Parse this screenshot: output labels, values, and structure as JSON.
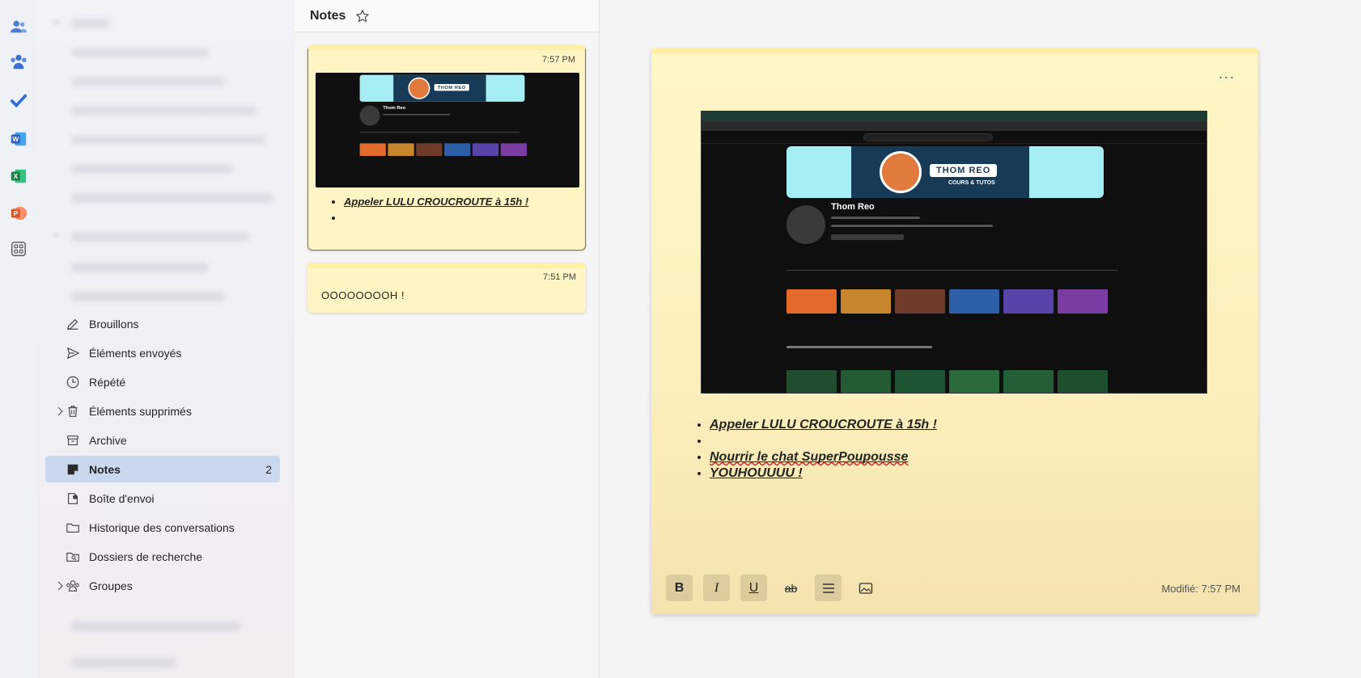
{
  "rail": {
    "icons": [
      "people-icon",
      "teams-icon",
      "todo-icon",
      "word-icon",
      "excel-icon",
      "powerpoint-icon",
      "apps-icon"
    ],
    "colors": {
      "people": "#4a7dd6",
      "teams": "#3a6fd1",
      "todo": "#2f6ed8",
      "word": "#2b5fbd",
      "excel": "#1e7f45",
      "powerpoint": "#d45a2f",
      "apps": "#555555"
    }
  },
  "folders": {
    "items": [
      {
        "label": "Brouillons",
        "icon": "draft-icon"
      },
      {
        "label": "Éléments envoyés",
        "icon": "send-icon"
      },
      {
        "label": "Répété",
        "icon": "clock-icon"
      },
      {
        "label": "Éléments supprimés",
        "icon": "trash-icon"
      },
      {
        "label": "Archive",
        "icon": "archive-icon"
      },
      {
        "label": "Notes",
        "icon": "note-icon",
        "count": "2"
      },
      {
        "label": "Boîte d'envoi",
        "icon": "outbox-icon"
      },
      {
        "label": "Historique des conversations",
        "icon": "folder-icon"
      },
      {
        "label": "Dossiers de recherche",
        "icon": "search-folder-icon"
      },
      {
        "label": "Groupes",
        "icon": "groups-icon"
      }
    ],
    "selected": "Notes"
  },
  "list": {
    "title": "Notes",
    "notes": [
      {
        "time": "7:57 PM",
        "items": [
          "Appeler LULU CROUCROUTE à 15h !",
          ""
        ]
      },
      {
        "time": "7:51 PM",
        "text": "OOOOOOOOH !"
      }
    ]
  },
  "editor": {
    "items": [
      "Appeler LULU CROUCROUTE à 15h !",
      "",
      "Nourrir le chat SuperPoupousse",
      "YOUHOUUUU !"
    ],
    "toolbar": {
      "bold": "B",
      "italic": "I",
      "underline": "U",
      "strike": "ab"
    },
    "modified": "Modifié: 7:57 PM",
    "image": {
      "channel_name": "Thom Reo",
      "banner_text": "THOM REO",
      "banner_sub": "COURS & TUTOS"
    }
  }
}
